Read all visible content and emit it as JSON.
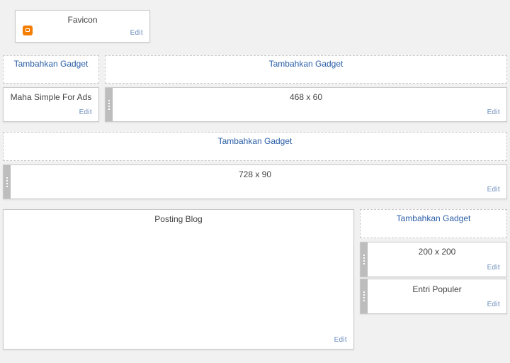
{
  "favicon": {
    "title": "Favicon",
    "edit": "Edit",
    "icon": "blogger-icon"
  },
  "add_gadget_label": "Tambahkan Gadget",
  "edit_label": "Edit",
  "header_left": {
    "title": "Maha Simple For Ads"
  },
  "header_ad": {
    "title": "468 x 60"
  },
  "crosscol_ad": {
    "title": "728 x 90"
  },
  "main": {
    "title": "Posting Blog"
  },
  "sidebar": {
    "ad": {
      "title": "200 x 200"
    },
    "popular": {
      "title": "Entri Populer"
    }
  },
  "colors": {
    "background": "#f1f1f1",
    "link": "#2b5fa7",
    "handle": "#bdbdbd",
    "blogger": "#f57d00"
  }
}
